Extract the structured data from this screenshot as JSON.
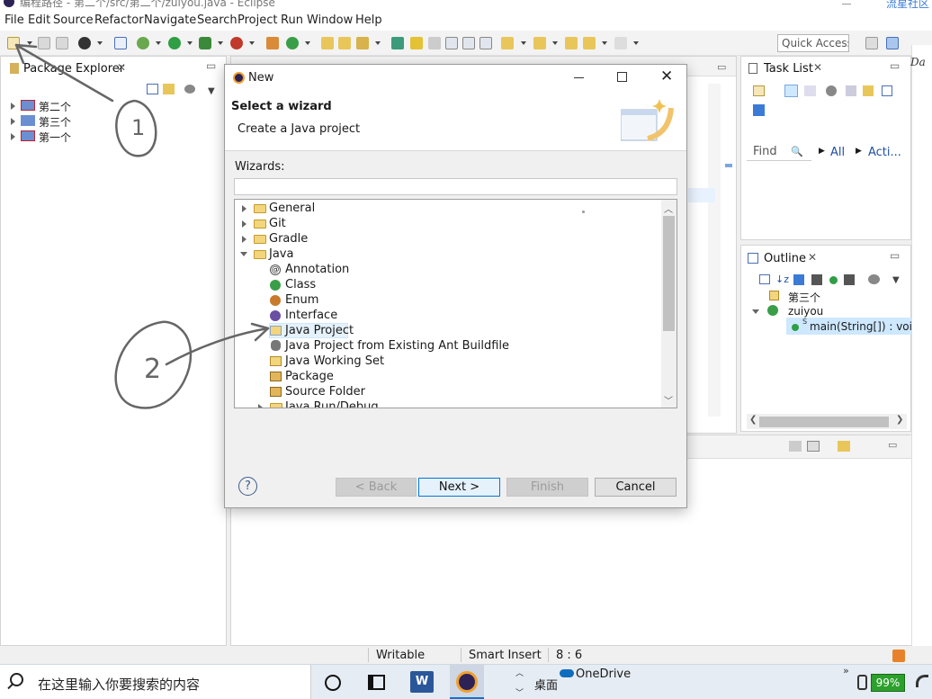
{
  "window": {
    "title": "编程路径 - 第二个/src/第二个/zuiyou.java - Eclipse",
    "corner_text": "流星社区"
  },
  "menu": {
    "items": [
      "File",
      "Edit",
      "Source",
      "Refactor",
      "Navigate",
      "Search",
      "Project",
      "Run",
      "Window",
      "Help"
    ]
  },
  "toolbar": {
    "quick_access": "Quick Access"
  },
  "package_explorer": {
    "tab_label": "Package Explorer",
    "projects": [
      "第二个",
      "第三个",
      "第一个"
    ]
  },
  "task_list": {
    "tab_label": "Task List",
    "find_placeholder": "Find",
    "filter_all": "All",
    "filter_acti": "Acti..."
  },
  "outline": {
    "tab_label": "Outline",
    "items": [
      "第三个",
      "zuiyou",
      "main(String[]) : void"
    ],
    "method_modifier": "S"
  },
  "dialog": {
    "title": "New",
    "heading": "Select a wizard",
    "subheading": "Create a Java project",
    "wizards_label": "Wizards:",
    "filter_value": "",
    "tree": {
      "general": "General",
      "git": "Git",
      "gradle": "Gradle",
      "java": "Java",
      "annotation": "Annotation",
      "class": "Class",
      "enum": "Enum",
      "interface": "Interface",
      "java_project": "Java Project",
      "java_project_ant": "Java Project from Existing Ant Buildfile",
      "java_working_set": "Java Working Set",
      "package": "Package",
      "source_folder": "Source Folder",
      "java_run_debug": "Java Run/Debug"
    },
    "buttons": {
      "help": "?",
      "back": "< Back",
      "next": "Next >",
      "finish": "Finish",
      "cancel": "Cancel"
    }
  },
  "status_bar": {
    "writable": "Writable",
    "insert_mode": "Smart Insert",
    "position": "8 : 6"
  },
  "taskbar": {
    "search_placeholder": "在这里输入你要搜索的内容",
    "desktop_label": "桌面",
    "onedrive_label": "OneDrive",
    "battery": "99%"
  },
  "annotations": {
    "label_1": "1",
    "label_2": "2"
  },
  "colors": {
    "accent_blue": "#0078d7",
    "selection": "#cde8ff",
    "battery_green": "#2ca02c"
  }
}
